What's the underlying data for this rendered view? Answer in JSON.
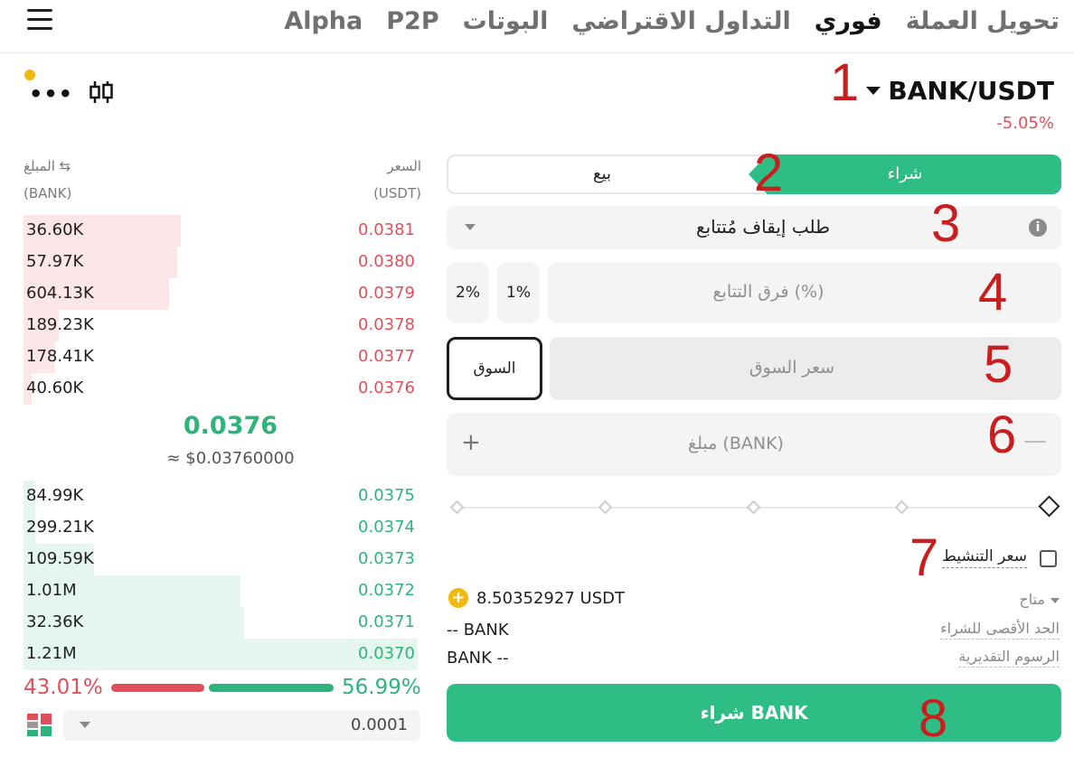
{
  "nav": {
    "tabs": [
      "تحويل العملة",
      "فوري",
      "التداول الاقتراضي",
      "البوتات",
      "P2P",
      "Alpha"
    ],
    "active_index": 1
  },
  "pair": {
    "symbol": "BANK/USDT",
    "change": "-5.05%"
  },
  "orderbook": {
    "price_header": "السعر",
    "price_unit": "(USDT)",
    "amount_header": "المبلغ ⇆",
    "amount_unit": "(BANK)",
    "asks": [
      {
        "amount": "36.60K",
        "price": "0.0381",
        "depth": 0.4
      },
      {
        "amount": "57.97K",
        "price": "0.0380",
        "depth": 0.39
      },
      {
        "amount": "604.13K",
        "price": "0.0379",
        "depth": 0.37
      },
      {
        "amount": "189.23K",
        "price": "0.0378",
        "depth": 0.09
      },
      {
        "amount": "178.41K",
        "price": "0.0377",
        "depth": 0.08
      },
      {
        "amount": "40.60K",
        "price": "0.0376",
        "depth": 0.02
      }
    ],
    "mid_price": "0.0376",
    "mid_usd": "≈ $0.03760000",
    "bids": [
      {
        "amount": "84.99K",
        "price": "0.0375",
        "depth": 0.03
      },
      {
        "amount": "299.21K",
        "price": "0.0374",
        "depth": 0.03
      },
      {
        "amount": "109.59K",
        "price": "0.0373",
        "depth": 0.18
      },
      {
        "amount": "1.01M",
        "price": "0.0372",
        "depth": 0.55
      },
      {
        "amount": "32.36K",
        "price": "0.0371",
        "depth": 0.56
      },
      {
        "amount": "1.21M",
        "price": "0.0370",
        "depth": 1.0
      }
    ],
    "sell_ratio": "43.01%",
    "buy_ratio": "56.99%",
    "precision": "0.0001"
  },
  "form": {
    "tab_buy": "شراء",
    "tab_sell": "بيع",
    "order_type": "طلب إيقاف مُتتابع",
    "pct_2": "2%",
    "pct_1": "1%",
    "trail_placeholder": "فرق التتابع (%)",
    "market_label": "السوق",
    "market_price_placeholder": "سعر السوق",
    "amount_placeholder": "مبلغ (BANK)",
    "plus": "+",
    "minus": "—",
    "activation_label": "سعر التنشيط",
    "available_label": "متاح",
    "available_value": "8.50352927 USDT",
    "max_buy_label": "الحد الأقصى للشراء",
    "max_buy_value": "-- BANK",
    "fees_label": "الرسوم التقديرية",
    "fees_value": "BANK --",
    "buy_button": "شراء BANK"
  },
  "annotations": [
    "1",
    "2",
    "3",
    "4",
    "5",
    "6",
    "7",
    "8"
  ],
  "colors": {
    "buy": "#2ebd85",
    "sell": "#e0505b",
    "coin": "#f0b90b"
  }
}
